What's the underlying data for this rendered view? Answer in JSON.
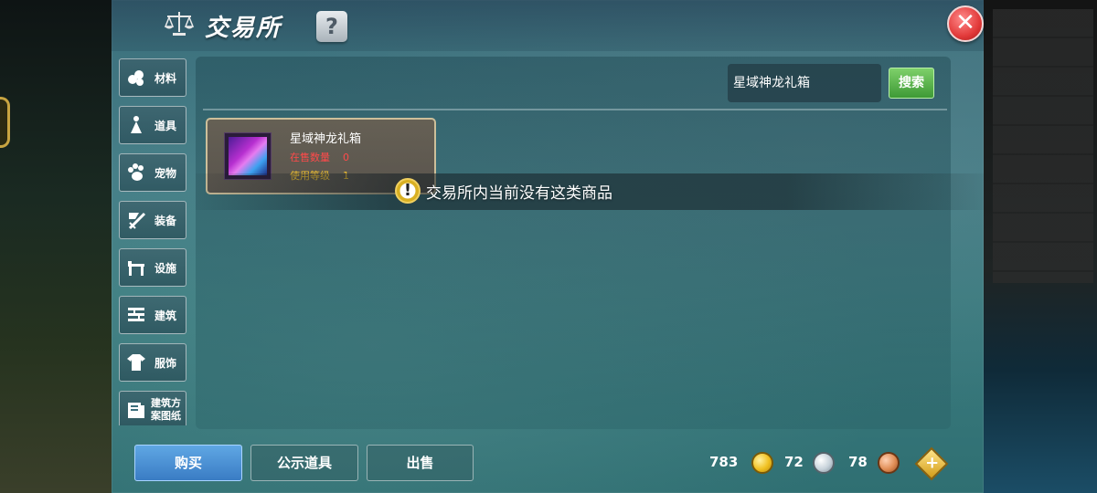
{
  "window": {
    "title": "交易所",
    "help_label": "?",
    "close_label": "✕"
  },
  "sidebar": {
    "items": [
      {
        "label": "材料",
        "icon": "material-icon"
      },
      {
        "label": "道具",
        "icon": "item-icon"
      },
      {
        "label": "宠物",
        "icon": "paw-icon"
      },
      {
        "label": "装备",
        "icon": "equipment-icon"
      },
      {
        "label": "设施",
        "icon": "facility-icon"
      },
      {
        "label": "建筑",
        "icon": "building-icon"
      },
      {
        "label": "服饰",
        "icon": "clothing-icon"
      },
      {
        "label": "建筑方案图纸",
        "icon": "blueprint-icon"
      }
    ]
  },
  "search": {
    "value": "星域神龙礼箱",
    "button_label": "搜索"
  },
  "item_card": {
    "name": "星域神龙礼箱",
    "on_sale_label": "在售数量",
    "on_sale_value": "0",
    "level_label": "使用等级",
    "level_value": "1"
  },
  "toast": {
    "icon": "!",
    "message": "交易所内当前没有这类商品"
  },
  "bottom_tabs": {
    "buy": "购买",
    "showcase": "公示道具",
    "sell": "出售"
  },
  "currency": {
    "gold": "783",
    "silver": "72",
    "copper": "78",
    "add_label": "+"
  },
  "colors": {
    "panel_bg": "#447d86",
    "accent_green": "#3e9a36",
    "accent_blue": "#3a7cc4",
    "sale_red": "#ff4a4a",
    "level_yellow": "#f0c030",
    "close_red": "#e23a3a"
  }
}
